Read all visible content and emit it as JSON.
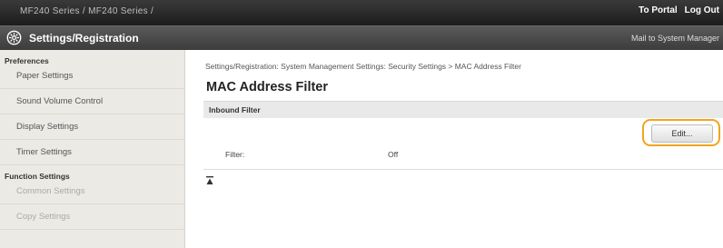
{
  "header": {
    "device_name": "MF240 Series / MF240 Series /",
    "to_portal": "To Portal",
    "log_out": "Log Out"
  },
  "subheader": {
    "title": "Settings/Registration",
    "mail_to_manager": "Mail to System Manager",
    "icon": "settings-gear-icon"
  },
  "sidebar": {
    "sections": [
      {
        "title": "Preferences",
        "items": [
          {
            "label": "Paper Settings"
          },
          {
            "label": "Sound Volume Control"
          },
          {
            "label": "Display Settings"
          },
          {
            "label": "Timer Settings"
          }
        ]
      },
      {
        "title": "Function Settings",
        "items": [
          {
            "label": "Common Settings"
          },
          {
            "label": "Copy Settings"
          }
        ]
      }
    ]
  },
  "main": {
    "breadcrumb": "Settings/Registration: System Management Settings: Security Settings > MAC Address Filter",
    "page_title": "MAC Address Filter",
    "section_title": "Inbound Filter",
    "edit_button": "Edit...",
    "filter_label": "Filter:",
    "filter_value": "Off",
    "highlight_color": "#f1a51e",
    "to_top_icon": "arrow-to-top-icon"
  }
}
